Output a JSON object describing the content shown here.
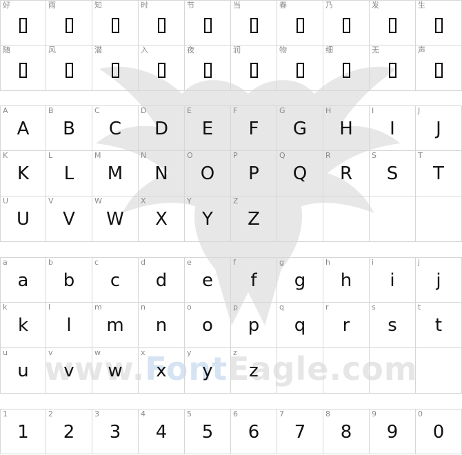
{
  "watermark": {
    "prefix": "www.",
    "highlight": "Font",
    "suffix": "Eagle.com"
  },
  "sections": [
    {
      "id": "cjk",
      "rows": [
        [
          {
            "label": "好",
            "glyph": ""
          },
          {
            "label": "雨",
            "glyph": ""
          },
          {
            "label": "知",
            "glyph": ""
          },
          {
            "label": "时",
            "glyph": ""
          },
          {
            "label": "节",
            "glyph": ""
          },
          {
            "label": "当",
            "glyph": ""
          },
          {
            "label": "春",
            "glyph": ""
          },
          {
            "label": "乃",
            "glyph": ""
          },
          {
            "label": "发",
            "glyph": ""
          },
          {
            "label": "生",
            "glyph": ""
          }
        ],
        [
          {
            "label": "随",
            "glyph": ""
          },
          {
            "label": "风",
            "glyph": ""
          },
          {
            "label": "潜",
            "glyph": ""
          },
          {
            "label": "入",
            "glyph": ""
          },
          {
            "label": "夜",
            "glyph": ""
          },
          {
            "label": "润",
            "glyph": ""
          },
          {
            "label": "物",
            "glyph": ""
          },
          {
            "label": "细",
            "glyph": ""
          },
          {
            "label": "无",
            "glyph": ""
          },
          {
            "label": "声",
            "glyph": ""
          }
        ]
      ]
    },
    {
      "id": "upper",
      "rows": [
        [
          {
            "label": "A",
            "glyph": "A"
          },
          {
            "label": "B",
            "glyph": "B"
          },
          {
            "label": "C",
            "glyph": "C"
          },
          {
            "label": "D",
            "glyph": "D"
          },
          {
            "label": "E",
            "glyph": "E"
          },
          {
            "label": "F",
            "glyph": "F"
          },
          {
            "label": "G",
            "glyph": "G"
          },
          {
            "label": "H",
            "glyph": "H"
          },
          {
            "label": "I",
            "glyph": "I"
          },
          {
            "label": "J",
            "glyph": "J"
          }
        ],
        [
          {
            "label": "K",
            "glyph": "K"
          },
          {
            "label": "L",
            "glyph": "L"
          },
          {
            "label": "M",
            "glyph": "M"
          },
          {
            "label": "N",
            "glyph": "N"
          },
          {
            "label": "O",
            "glyph": "O"
          },
          {
            "label": "P",
            "glyph": "P"
          },
          {
            "label": "Q",
            "glyph": "Q"
          },
          {
            "label": "R",
            "glyph": "R"
          },
          {
            "label": "S",
            "glyph": "S"
          },
          {
            "label": "T",
            "glyph": "T"
          }
        ],
        [
          {
            "label": "U",
            "glyph": "U"
          },
          {
            "label": "V",
            "glyph": "V"
          },
          {
            "label": "W",
            "glyph": "W"
          },
          {
            "label": "X",
            "glyph": "X"
          },
          {
            "label": "Y",
            "glyph": "Y"
          },
          {
            "label": "Z",
            "glyph": "Z"
          },
          {
            "label": "",
            "glyph": ""
          },
          {
            "label": "",
            "glyph": ""
          },
          {
            "label": "",
            "glyph": ""
          },
          {
            "label": "",
            "glyph": ""
          }
        ]
      ]
    },
    {
      "id": "lower",
      "rows": [
        [
          {
            "label": "a",
            "glyph": "a"
          },
          {
            "label": "b",
            "glyph": "b"
          },
          {
            "label": "c",
            "glyph": "c"
          },
          {
            "label": "d",
            "glyph": "d"
          },
          {
            "label": "e",
            "glyph": "e"
          },
          {
            "label": "f",
            "glyph": "f"
          },
          {
            "label": "g",
            "glyph": "g"
          },
          {
            "label": "h",
            "glyph": "h"
          },
          {
            "label": "i",
            "glyph": "i"
          },
          {
            "label": "j",
            "glyph": "j"
          }
        ],
        [
          {
            "label": "k",
            "glyph": "k"
          },
          {
            "label": "l",
            "glyph": "l"
          },
          {
            "label": "m",
            "glyph": "m"
          },
          {
            "label": "n",
            "glyph": "n"
          },
          {
            "label": "o",
            "glyph": "o"
          },
          {
            "label": "p",
            "glyph": "p"
          },
          {
            "label": "q",
            "glyph": "q"
          },
          {
            "label": "r",
            "glyph": "r"
          },
          {
            "label": "s",
            "glyph": "s"
          },
          {
            "label": "t",
            "glyph": "t"
          }
        ],
        [
          {
            "label": "u",
            "glyph": "u"
          },
          {
            "label": "v",
            "glyph": "v"
          },
          {
            "label": "w",
            "glyph": "w"
          },
          {
            "label": "x",
            "glyph": "x"
          },
          {
            "label": "y",
            "glyph": "y"
          },
          {
            "label": "z",
            "glyph": "z"
          },
          {
            "label": "",
            "glyph": ""
          },
          {
            "label": "",
            "glyph": ""
          },
          {
            "label": "",
            "glyph": ""
          },
          {
            "label": "",
            "glyph": ""
          }
        ]
      ]
    },
    {
      "id": "digits",
      "rows": [
        [
          {
            "label": "1",
            "glyph": "1"
          },
          {
            "label": "2",
            "glyph": "2"
          },
          {
            "label": "3",
            "glyph": "3"
          },
          {
            "label": "4",
            "glyph": "4"
          },
          {
            "label": "5",
            "glyph": "5"
          },
          {
            "label": "6",
            "glyph": "6"
          },
          {
            "label": "7",
            "glyph": "7"
          },
          {
            "label": "8",
            "glyph": "8"
          },
          {
            "label": "9",
            "glyph": "9"
          },
          {
            "label": "0",
            "glyph": "0"
          }
        ]
      ]
    }
  ]
}
